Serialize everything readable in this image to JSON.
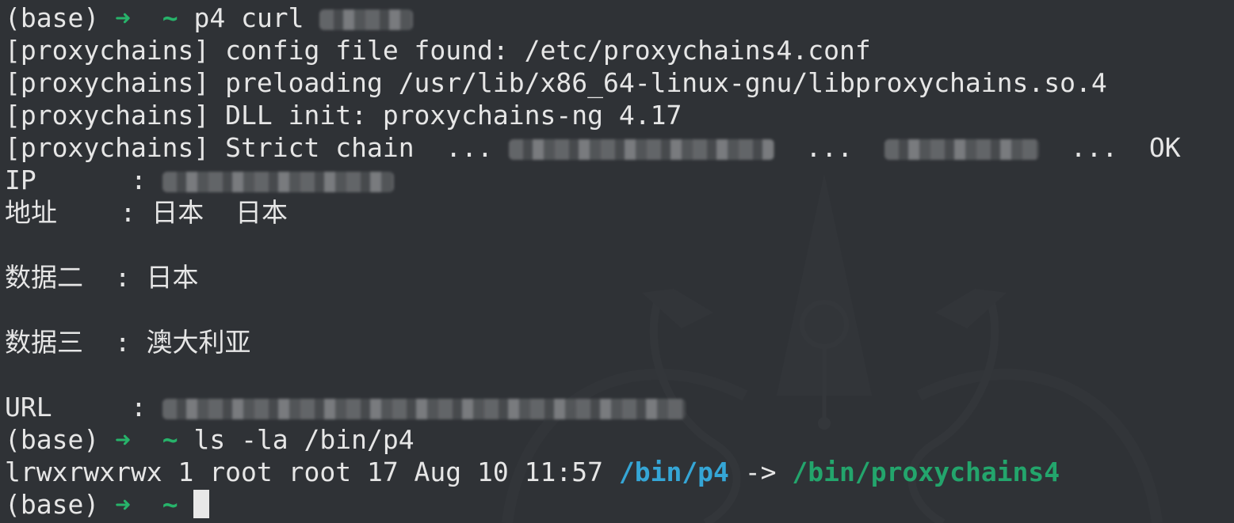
{
  "prompt": {
    "env": "(base)",
    "arrow": "➜",
    "dir": "~"
  },
  "lines": {
    "l1_cmd": "p4 curl",
    "l2": "[proxychains] config file found: /etc/proxychains4.conf",
    "l3": "[proxychains] preloading /usr/lib/x86_64-linux-gnu/libproxychains.so.4",
    "l4": "[proxychains] DLL init: proxychains-ng 4.17",
    "l5_prefix": "[proxychains] Strict chain  ... ",
    "l5_mid": "  ...  ",
    "l5_suffix": "  ...  OK",
    "ip_label": "IP      : ",
    "addr_label": "地址    : ",
    "addr_value": "日本  日本",
    "data2_label": "数据二  : ",
    "data2_value": "日本",
    "data3_label": "数据三  : ",
    "data3_value": "澳大利亚",
    "url_label": "URL     : ",
    "l_ls_cmd": "ls -la /bin/p4",
    "ls_out": "lrwxrwxrwx 1 root root 17 Aug 10 11:57 ",
    "ls_link": "/bin/p4",
    "ls_arrow": " -> ",
    "ls_target": "/bin/proxychains4"
  },
  "colors": {
    "background": "#2f3236",
    "text": "#e6e6e6",
    "prompt_arrow": "#27b36a",
    "symlink": "#35a6d6",
    "exec_target": "#23a56c"
  }
}
